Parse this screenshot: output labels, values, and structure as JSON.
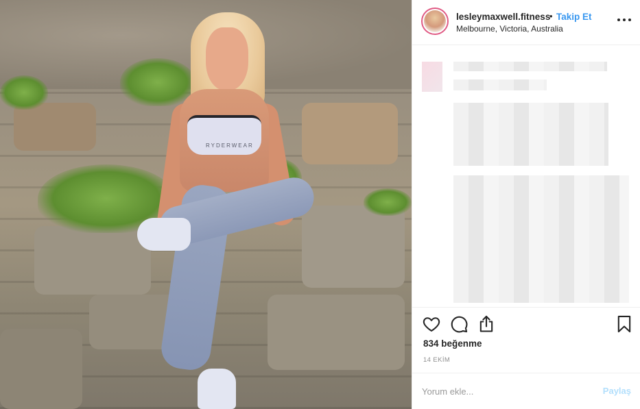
{
  "post": {
    "username": "lesleymaxwell.fitness",
    "separator": "•",
    "follow_label": "Takip Et",
    "location": "Melbourne, Victoria, Australia",
    "photo_brand_text": "RYDERWEAR"
  },
  "icons": {
    "more": "more-options-icon",
    "like": "heart-icon",
    "comment": "comment-bubble-icon",
    "share": "share-icon",
    "save": "bookmark-icon"
  },
  "stats": {
    "likes": "834 beğenme",
    "date": "14 EKİM"
  },
  "comment_box": {
    "placeholder": "Yorum ekle...",
    "share_label": "Paylaş"
  },
  "colors": {
    "accent": "#3897f0",
    "share_disabled": "#b2dffc",
    "text": "#262626",
    "muted": "#8e8e8e"
  }
}
